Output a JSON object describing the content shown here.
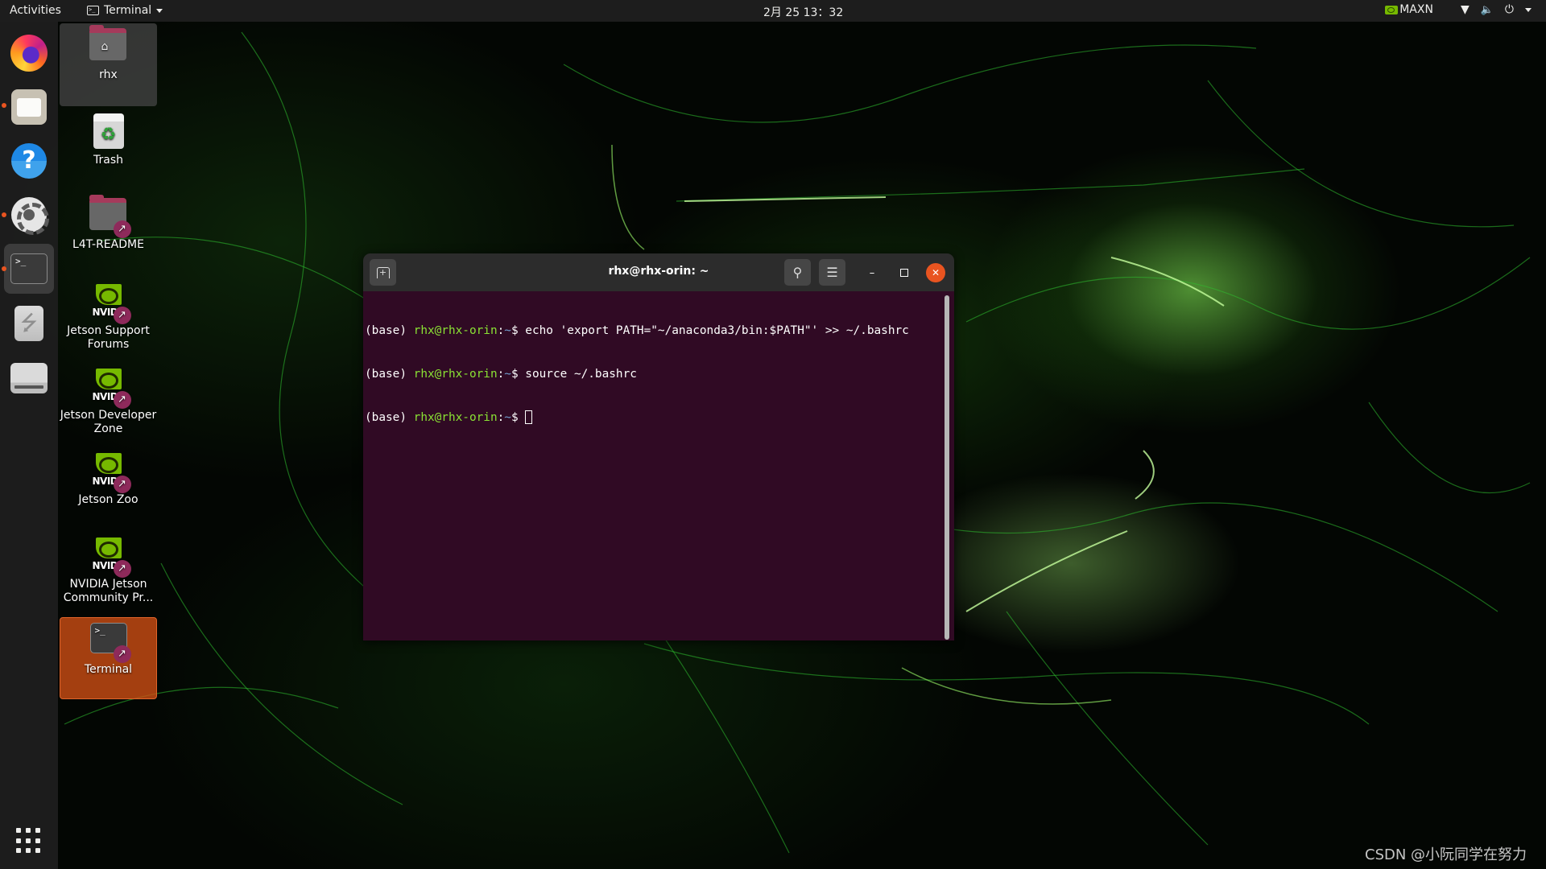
{
  "topbar": {
    "activities_label": "Activities",
    "app_menu_label": "Terminal",
    "clock": "2月 25  13：32",
    "power_mode": "MAXN",
    "tray_icons": [
      "nvidia-icon",
      "wifi-icon",
      "volume-icon",
      "power-icon",
      "chevron-down-icon"
    ]
  },
  "dock": {
    "items": [
      {
        "name": "Firefox",
        "icon": "firefox-icon",
        "running": false
      },
      {
        "name": "Files",
        "icon": "files-icon",
        "running": true
      },
      {
        "name": "Help",
        "icon": "help-icon",
        "running": false,
        "glyph": "?"
      },
      {
        "name": "Settings",
        "icon": "settings-icon",
        "running": true
      },
      {
        "name": "Terminal",
        "icon": "terminal-icon",
        "running": true,
        "active": true,
        "glyph": ">_"
      },
      {
        "name": "USB Drive",
        "icon": "usb-icon",
        "running": false,
        "glyph": "⭍"
      },
      {
        "name": "Drive",
        "icon": "drive-icon",
        "running": false
      }
    ],
    "show_apps_label": "Show Applications"
  },
  "desktop": {
    "icons": [
      {
        "label": "rhx",
        "type": "home-folder",
        "selected": true
      },
      {
        "label": "Trash",
        "type": "trash"
      },
      {
        "label": "L4T-README",
        "type": "folder-link"
      },
      {
        "label": "Jetson Support Forums",
        "type": "nvidia-link"
      },
      {
        "label": "Jetson Developer Zone",
        "type": "nvidia-link"
      },
      {
        "label": "Jetson Zoo",
        "type": "nvidia-link"
      },
      {
        "label": "NVIDIA Jetson Community Pr...",
        "type": "nvidia-link"
      },
      {
        "label": "Terminal",
        "type": "terminal-link",
        "selected": true
      }
    ],
    "nvidia_wordmark": "NVIDIA",
    "link_glyph": "↗",
    "home_glyph": "⌂",
    "trash_glyph": "♻",
    "terminal_glyph": ">_"
  },
  "terminal": {
    "title": "rhx@rhx-orin: ~",
    "new_tab_glyph": "+",
    "search_glyph": "⚲",
    "menu_glyph": "☰",
    "minimize_glyph": "–",
    "close_glyph": "✕",
    "lines": [
      {
        "env": "(base) ",
        "user": "rhx@rhx-orin",
        "sep": ":",
        "path": "~",
        "dollar": "$ ",
        "command": "echo 'export PATH=\"~/anaconda3/bin:$PATH\"' >> ~/.bashrc"
      },
      {
        "env": "(base) ",
        "user": "rhx@rhx-orin",
        "sep": ":",
        "path": "~",
        "dollar": "$ ",
        "command": "source ~/.bashrc"
      },
      {
        "env": "(base) ",
        "user": "rhx@rhx-orin",
        "sep": ":",
        "path": "~",
        "dollar": "$ ",
        "command": ""
      }
    ]
  },
  "colors": {
    "accent": "#e95420",
    "terminal_bg": "#300a24",
    "prompt_user": "#8ae234",
    "prompt_path": "#729fcf",
    "nvidia_green": "#76b900",
    "link_badge": "#8e2a5b"
  },
  "watermark": "CSDN @小阮同学在努力"
}
